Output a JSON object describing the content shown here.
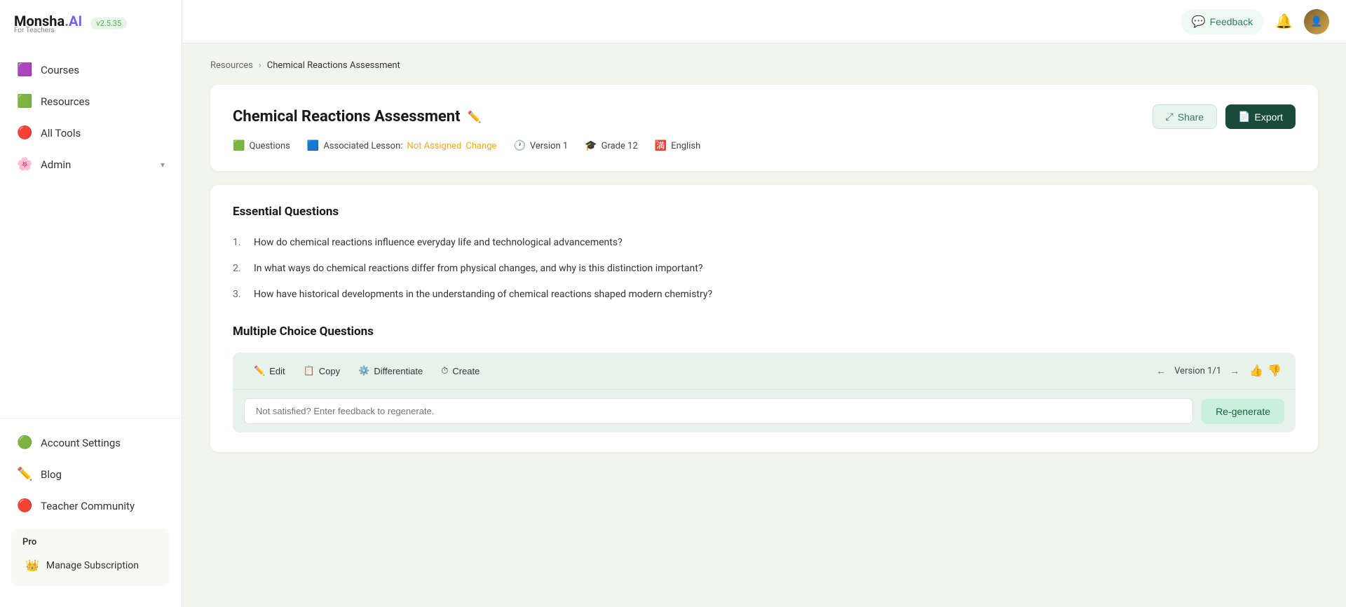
{
  "app": {
    "name": "Monsha",
    "name_suffix": ".AI",
    "tagline": "For Teachers",
    "version": "v2.5.35"
  },
  "sidebar": {
    "nav_items": [
      {
        "id": "courses",
        "label": "Courses",
        "icon": "🟪"
      },
      {
        "id": "resources",
        "label": "Resources",
        "icon": "🟩"
      },
      {
        "id": "all-tools",
        "label": "All Tools",
        "icon": "🔴"
      },
      {
        "id": "admin",
        "label": "Admin",
        "icon": "🌸",
        "has_arrow": true
      }
    ],
    "bottom_items": [
      {
        "id": "account-settings",
        "label": "Account Settings",
        "icon": "🟢"
      },
      {
        "id": "blog",
        "label": "Blog",
        "icon": "✏️"
      },
      {
        "id": "teacher-community",
        "label": "Teacher Community",
        "icon": "🔴"
      }
    ],
    "pro_section": {
      "label": "Pro",
      "items": [
        {
          "id": "manage-subscription",
          "label": "Manage Subscription",
          "icon": "👑"
        }
      ]
    }
  },
  "topbar": {
    "feedback_label": "Feedback",
    "notification_icon": "🔔"
  },
  "breadcrumb": {
    "parent": "Resources",
    "separator": "›",
    "current": "Chemical Reactions Assessment"
  },
  "assessment": {
    "title": "Chemical Reactions Assessment",
    "share_label": "Share",
    "export_label": "Export",
    "meta": {
      "questions_label": "Questions",
      "associated_lesson_label": "Associated Lesson:",
      "not_assigned": "Not Assigned",
      "change_label": "Change",
      "version_label": "Version 1",
      "grade_label": "Grade 12",
      "language_label": "English"
    }
  },
  "content": {
    "essential_questions_title": "Essential Questions",
    "essential_questions": [
      "How do chemical reactions influence everyday life and technological advancements?",
      "In what ways do chemical reactions differ from physical changes, and why is this distinction important?",
      "How have historical developments in the understanding of chemical reactions shaped modern chemistry?"
    ],
    "mcq_title": "Multiple Choice Questions"
  },
  "toolbar": {
    "edit_label": "Edit",
    "copy_label": "Copy",
    "differentiate_label": "Differentiate",
    "create_label": "Create",
    "version_label": "Version 1/1",
    "regen_placeholder": "Not satisfied? Enter feedback to regenerate.",
    "regen_button": "Re-generate"
  }
}
